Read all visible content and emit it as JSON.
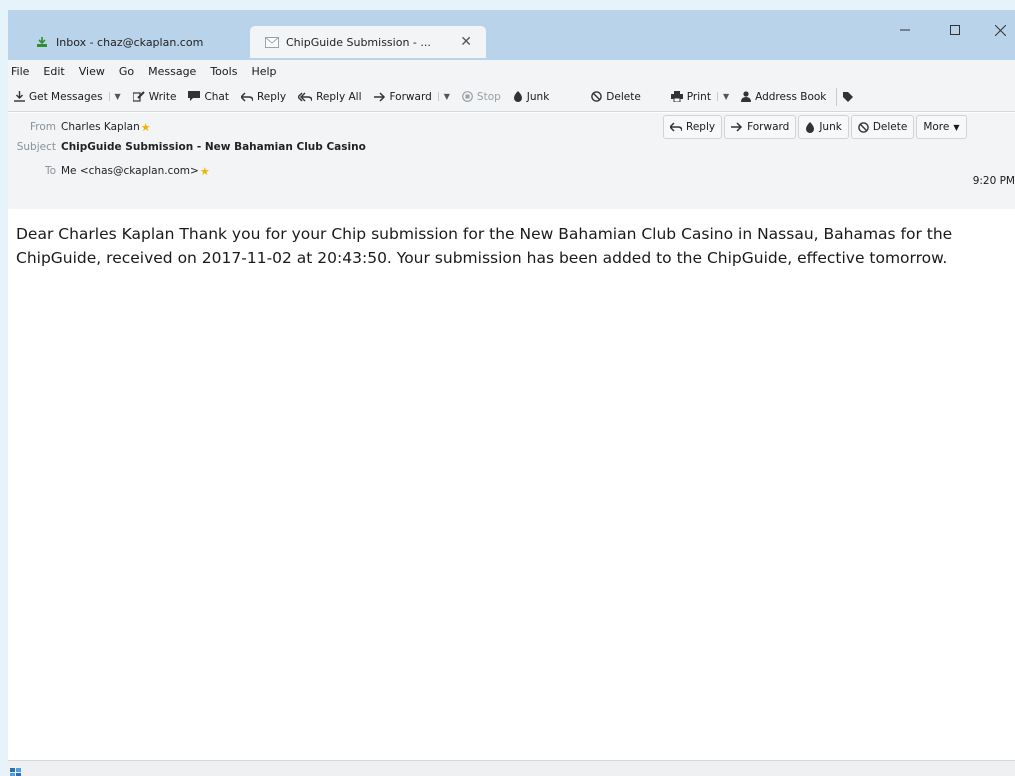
{
  "tabs": [
    {
      "label": "Inbox - chaz@ckaplan.com",
      "icon": "inbox-icon"
    },
    {
      "label": "ChipGuide Submission - ...",
      "icon": "envelope-icon"
    }
  ],
  "menu": [
    "File",
    "Edit",
    "View",
    "Go",
    "Message",
    "Tools",
    "Help"
  ],
  "toolbar": {
    "get_messages": "Get Messages",
    "write": "Write",
    "chat": "Chat",
    "reply": "Reply",
    "reply_all": "Reply All",
    "forward": "Forward",
    "stop": "Stop",
    "junk": "Junk",
    "delete": "Delete",
    "print": "Print",
    "address_book": "Address Book"
  },
  "header": {
    "from_label": "From",
    "from": "Charles Kaplan",
    "subject_label": "Subject",
    "subject": "ChipGuide Submission - New Bahamian Club Casino",
    "to_label": "To",
    "to": "Me <chas@ckaplan.com>",
    "date": "9:20 PM",
    "actions": {
      "reply": "Reply",
      "forward": "Forward",
      "junk": "Junk",
      "delete": "Delete",
      "more": "More"
    }
  },
  "body": {
    "text": "Dear Charles Kaplan Thank you for your Chip submission for the New Bahamian Club Casino in Nassau, Bahamas for the ChipGuide, received on 2017-11-02 at 20:43:50. Your submission has been added to the ChipGuide, effective tomorrow."
  },
  "colors": {
    "titlebar": "#b9d3ea",
    "chrome": "#f2f4f6",
    "label": "#8a9299",
    "star": "#f0b400"
  }
}
